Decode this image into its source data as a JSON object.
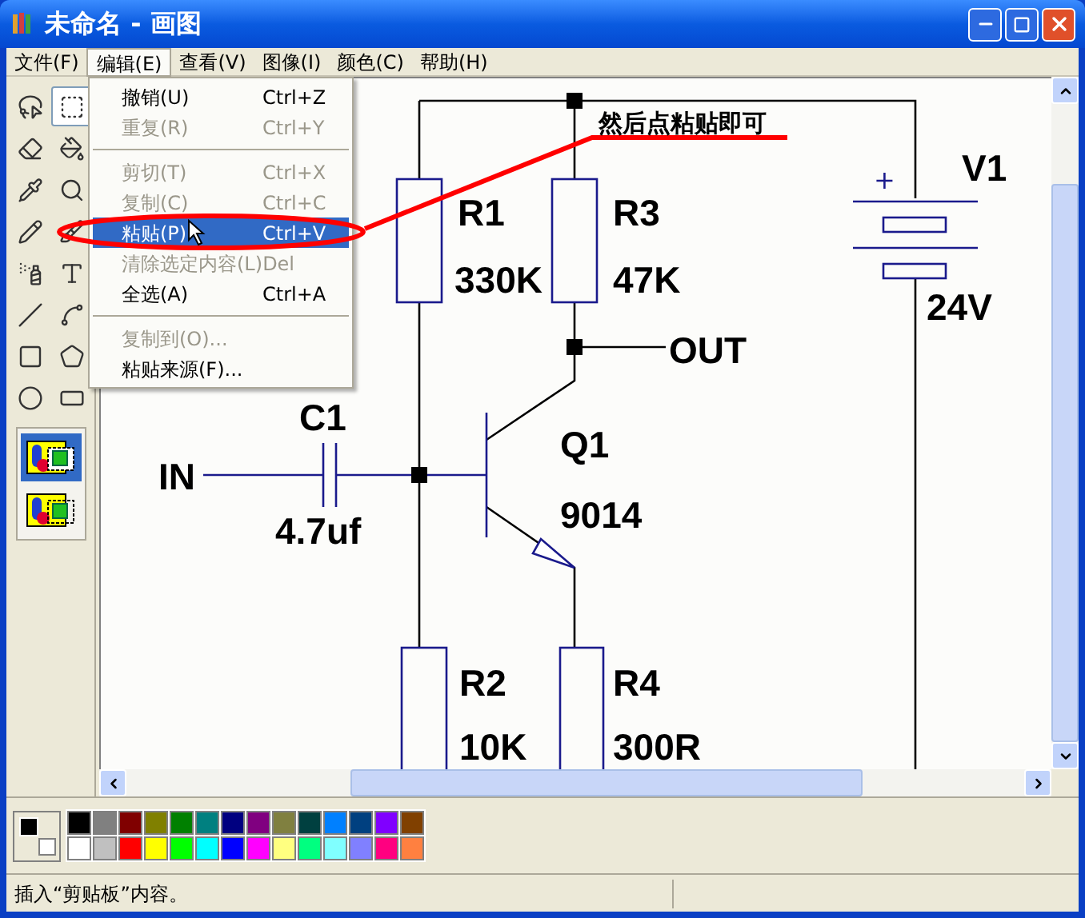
{
  "window": {
    "title": "未命名 - 画图"
  },
  "menu_bar": [
    {
      "label": "文件(F)",
      "open": false
    },
    {
      "label": "编辑(E)",
      "open": true
    },
    {
      "label": "查看(V)",
      "open": false
    },
    {
      "label": "图像(I)",
      "open": false
    },
    {
      "label": "颜色(C)",
      "open": false
    },
    {
      "label": "帮助(H)",
      "open": false
    }
  ],
  "edit_menu": [
    {
      "kind": "item",
      "label": "撤销(U)",
      "shortcut": "Ctrl+Z",
      "disabled": false,
      "selected": false
    },
    {
      "kind": "item",
      "label": "重复(R)",
      "shortcut": "Ctrl+Y",
      "disabled": true,
      "selected": false
    },
    {
      "kind": "separator"
    },
    {
      "kind": "item",
      "label": "剪切(T)",
      "shortcut": "Ctrl+X",
      "disabled": true,
      "selected": false
    },
    {
      "kind": "item",
      "label": "复制(C)",
      "shortcut": "Ctrl+C",
      "disabled": true,
      "selected": false
    },
    {
      "kind": "item",
      "label": "粘贴(P)",
      "shortcut": "Ctrl+V",
      "disabled": false,
      "selected": true
    },
    {
      "kind": "item",
      "label": "清除选定内容(L)",
      "shortcut": "Del",
      "disabled": true,
      "selected": false
    },
    {
      "kind": "item",
      "label": "全选(A)",
      "shortcut": "Ctrl+A",
      "disabled": false,
      "selected": false
    },
    {
      "kind": "separator"
    },
    {
      "kind": "item",
      "label": "复制到(O)...",
      "disabled": true,
      "selected": false
    },
    {
      "kind": "item",
      "label": "粘贴来源(F)...",
      "disabled": false,
      "selected": false
    }
  ],
  "tools": [
    {
      "kind": "free-select",
      "selected": false
    },
    {
      "kind": "rect-select",
      "selected": true
    },
    {
      "kind": "eraser",
      "selected": false
    },
    {
      "kind": "fill",
      "selected": false
    },
    {
      "kind": "picker",
      "selected": false
    },
    {
      "kind": "magnifier",
      "selected": false
    },
    {
      "kind": "pencil",
      "selected": false
    },
    {
      "kind": "brush",
      "selected": false
    },
    {
      "kind": "airbrush",
      "selected": false
    },
    {
      "kind": "text",
      "selected": false
    },
    {
      "kind": "line",
      "selected": false
    },
    {
      "kind": "curve",
      "selected": false
    },
    {
      "kind": "rectangle",
      "selected": false
    },
    {
      "kind": "polygon",
      "selected": false
    },
    {
      "kind": "ellipse",
      "selected": false
    },
    {
      "kind": "rounded-rectangle",
      "selected": false
    }
  ],
  "tool_options": [
    {
      "kind": "opaque",
      "selected": true
    },
    {
      "kind": "transparent",
      "selected": false
    }
  ],
  "canvas": {
    "labels": [
      "R1",
      "330K",
      "R3",
      "47K",
      "OUT",
      "V1",
      "24V",
      "C1",
      "IN",
      "4.7uf",
      "Q1",
      "9014",
      "R2",
      "10K",
      "R4",
      "300R"
    ],
    "plus_sign": "+",
    "annotation": "然后点粘贴即可"
  },
  "palette": {
    "foreground": {
      "color": "#000000"
    },
    "background": {
      "color": "#ffffff"
    },
    "colors": [
      {
        "color": "#000000"
      },
      {
        "color": "#808080"
      },
      {
        "color": "#800000"
      },
      {
        "color": "#808000"
      },
      {
        "color": "#008000"
      },
      {
        "color": "#008080"
      },
      {
        "color": "#000080"
      },
      {
        "color": "#800080"
      },
      {
        "color": "#808040"
      },
      {
        "color": "#004040"
      },
      {
        "color": "#0080ff"
      },
      {
        "color": "#004080"
      },
      {
        "color": "#8000ff"
      },
      {
        "color": "#804000"
      },
      {
        "color": "#ffffff"
      },
      {
        "color": "#c0c0c0"
      },
      {
        "color": "#ff0000"
      },
      {
        "color": "#ffff00"
      },
      {
        "color": "#00ff00"
      },
      {
        "color": "#00ffff"
      },
      {
        "color": "#0000ff"
      },
      {
        "color": "#ff00ff"
      },
      {
        "color": "#ffff80"
      },
      {
        "color": "#00ff80"
      },
      {
        "color": "#80ffff"
      },
      {
        "color": "#8080ff"
      },
      {
        "color": "#ff0080"
      },
      {
        "color": "#ff8040"
      }
    ]
  },
  "status_bar": {
    "text": "插入“剪贴板”内容。"
  }
}
